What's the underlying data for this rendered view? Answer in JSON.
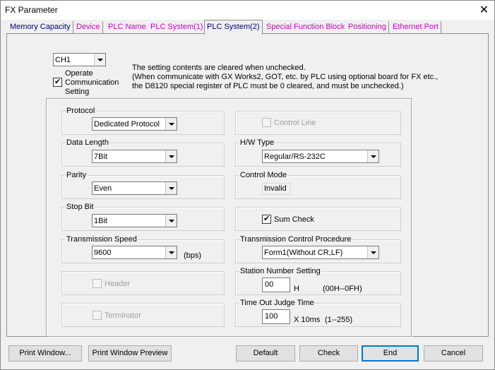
{
  "window": {
    "title": "FX Parameter",
    "close_glyph": "✕"
  },
  "tabs": [
    {
      "label": "Memory Capacity",
      "color": "#000080"
    },
    {
      "label": "Device",
      "color": "#cc00cc"
    },
    {
      "label": "PLC Name",
      "color": "#cc00cc"
    },
    {
      "label": "PLC System(1)",
      "color": "#cc00cc"
    },
    {
      "label": "PLC System(2)",
      "color": "#000080",
      "active": true
    },
    {
      "label": "Special Function Block",
      "color": "#cc00cc"
    },
    {
      "label": "Positioning",
      "color": "#cc00cc"
    },
    {
      "label": "Ethernet Port",
      "color": "#cc00cc"
    }
  ],
  "channel": {
    "value": "CH1"
  },
  "operate": {
    "label_line1": "Operate",
    "label_line2": "Communication",
    "label_line3": "Setting",
    "checked_glyph": "✔"
  },
  "notice": {
    "line1": "The setting contents are cleared when unchecked.",
    "line2": "(When communicate with GX Works2, GOT, etc. by PLC using optional board for FX etc.,",
    "line3": "the D8120 special register of PLC must be 0 cleared, and must be unchecked.)"
  },
  "protocol": {
    "label": "Protocol",
    "value": "Dedicated Protocol"
  },
  "data_length": {
    "label": "Data Length",
    "value": "7Bit"
  },
  "parity": {
    "label": "Parity",
    "value": "Even"
  },
  "stop_bit": {
    "label": "Stop Bit",
    "value": "1Bit"
  },
  "transmission_speed": {
    "label": "Transmission Speed",
    "value": "9600",
    "unit": "(bps)"
  },
  "header": {
    "label": "Header"
  },
  "terminator": {
    "label": "Terminator"
  },
  "control_line": {
    "label": "Control Line"
  },
  "hw_type": {
    "label": "H/W Type",
    "value": "Regular/RS-232C"
  },
  "control_mode": {
    "label": "Control Mode",
    "value": "Invalid"
  },
  "sum_check": {
    "label": "Sum Check",
    "checked_glyph": "✔"
  },
  "transmission_control": {
    "label": "Transmission Control Procedure",
    "value": "Form1(Without CR,LF)"
  },
  "station_number": {
    "label": "Station Number Setting",
    "value": "00",
    "unit": "H",
    "range": "(00H--0FH)"
  },
  "timeout": {
    "label": "Time Out Judge Time",
    "value": "100",
    "unit": "X 10ms",
    "range": "(1--255)"
  },
  "footer": {
    "print_window": "Print Window...",
    "print_preview": "Print Window Preview",
    "default": "Default",
    "check": "Check",
    "end": "End",
    "cancel": "Cancel"
  }
}
